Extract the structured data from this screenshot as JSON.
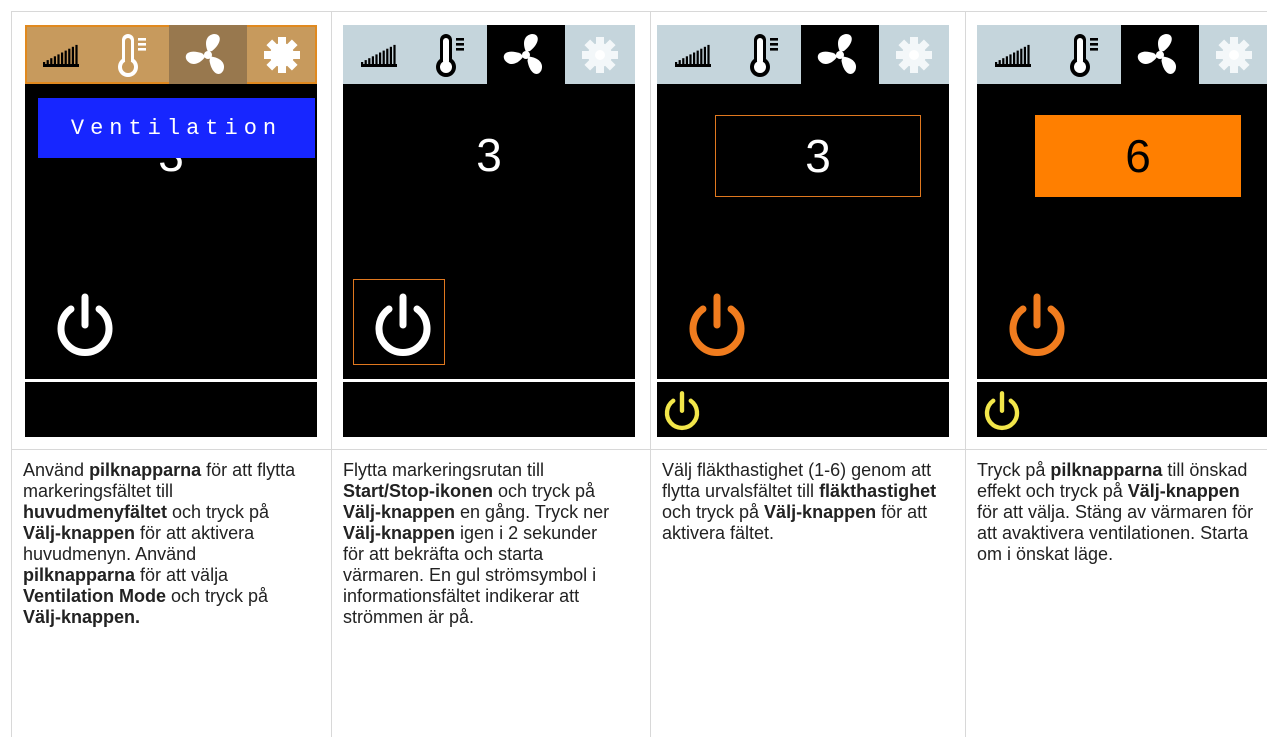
{
  "colors": {
    "screen_bg": "#000000",
    "topbar_bg": "#c5d5dc",
    "menu_highlight": "#c79a5d",
    "focus_orange": "#e0781f",
    "fill_orange": "#ff7f00",
    "banner_blue": "#1726ff",
    "power_white": "#ffffff",
    "power_orange": "#f07c1e",
    "power_yellow": "#f2e64a"
  },
  "icons": [
    "signal-bars-icon",
    "thermometer-icon",
    "fan-icon",
    "gear-icon",
    "power-icon"
  ],
  "panels": [
    {
      "banner": "Ventilation",
      "value": "3",
      "caption": [
        {
          "t": "Använd "
        },
        {
          "b": "pilknapparna"
        },
        {
          "t": " för att flytta markeringsfältet till "
        },
        {
          "b": "huvudmenyfältet"
        },
        {
          "t": " och tryck på "
        },
        {
          "b": "Välj-knappen"
        },
        {
          "t": " för att aktivera huvudmenyn. Använd "
        },
        {
          "b": "pilknapparna"
        },
        {
          "t": " för att välja "
        },
        {
          "b": "Ventilation Mode"
        },
        {
          "t": " och tryck på "
        },
        {
          "b": "Välj-knappen."
        }
      ]
    },
    {
      "value": "3",
      "caption": [
        {
          "t": "Flytta markeringsrutan till "
        },
        {
          "b": "Start/Stop-ikonen"
        },
        {
          "t": " och tryck på "
        },
        {
          "b": "Välj-knappen"
        },
        {
          "t": " en gång. Tryck ner "
        },
        {
          "b": "Välj-knappen"
        },
        {
          "t": " igen i 2 sekunder för att bekräfta och starta värmaren. En gul strömsymbol i informationsfältet indikerar att strömmen är på."
        }
      ]
    },
    {
      "value": "3",
      "caption": [
        {
          "t": "Välj fläkthastighet (1-6) genom att flytta urvalsfältet till "
        },
        {
          "b": "fläkthastighet"
        },
        {
          "t": " och tryck på "
        },
        {
          "b": "Välj-knappen"
        },
        {
          "t": " för att aktivera fältet."
        }
      ]
    },
    {
      "value": "6",
      "caption": [
        {
          "t": "Tryck på "
        },
        {
          "b": "pilknapparna"
        },
        {
          "t": " till önskad effekt och tryck på "
        },
        {
          "b": "Välj-knappen"
        },
        {
          "t": " för att välja. Stäng av värmaren för att avaktivera ventilationen. Starta om i önskat läge."
        }
      ]
    }
  ]
}
